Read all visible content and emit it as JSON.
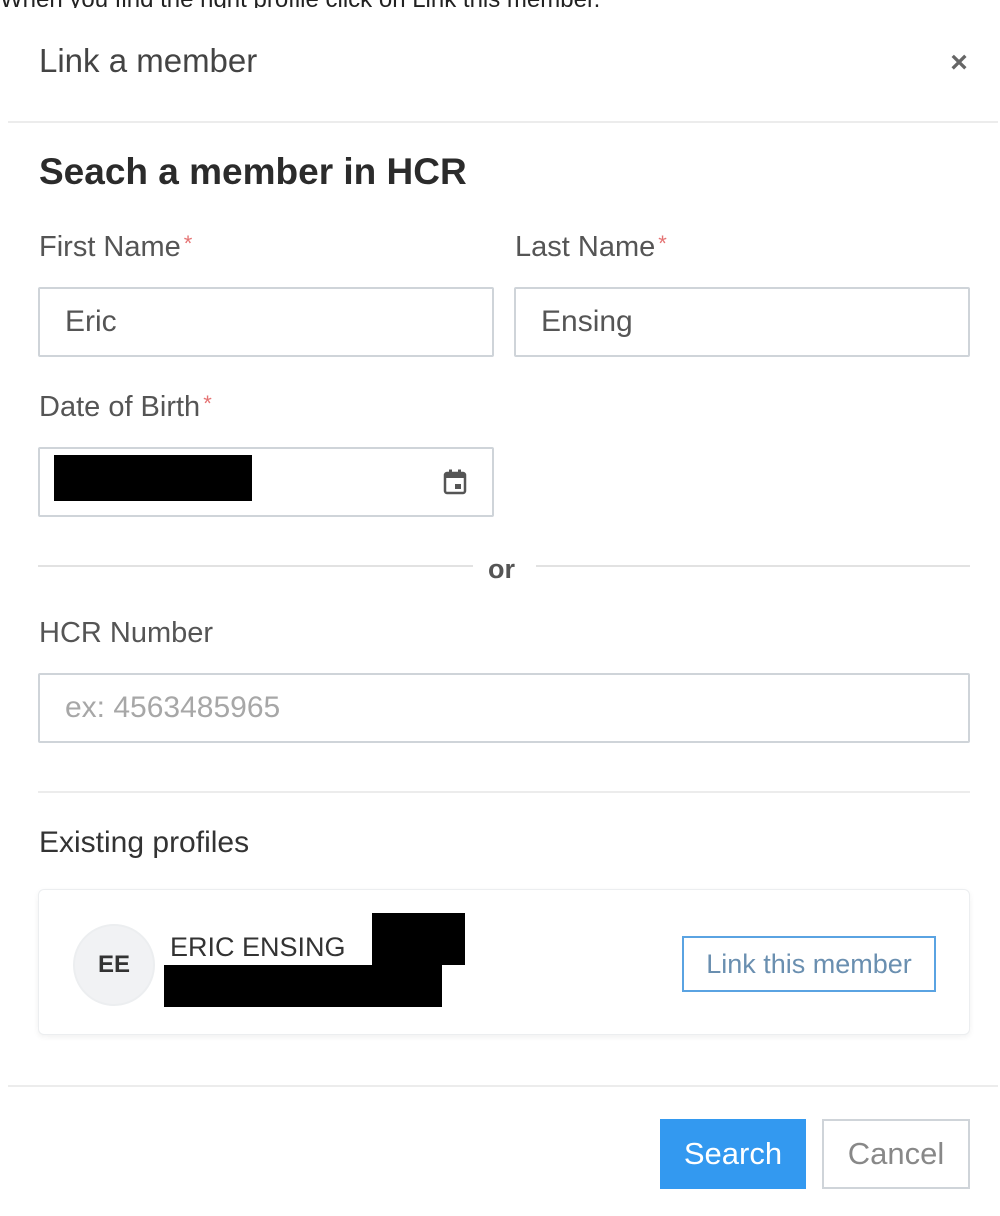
{
  "caption": "When you find the right profile click on Link this member.",
  "modal": {
    "title": "Link a member",
    "close_symbol": "×"
  },
  "form": {
    "heading": "Seach a member in HCR",
    "first_name": {
      "label": "First Name",
      "required_mark": "*",
      "value": "Eric"
    },
    "last_name": {
      "label": "Last Name",
      "required_mark": "*",
      "value": "Ensing"
    },
    "dob": {
      "label": "Date of Birth",
      "required_mark": "*",
      "icon": "calendar-icon"
    },
    "or_text": "or",
    "hcr_number": {
      "label": "HCR Number",
      "placeholder": "ex: 4563485965"
    }
  },
  "profiles": {
    "heading": "Existing profiles",
    "items": [
      {
        "initials": "EE",
        "name": "ERIC ENSING",
        "action_label": "Link this member"
      }
    ]
  },
  "footer": {
    "search_label": "Search",
    "cancel_label": "Cancel"
  },
  "colors": {
    "primary": "#3399f0",
    "required": "#e57373",
    "border": "#cfd4d9"
  }
}
